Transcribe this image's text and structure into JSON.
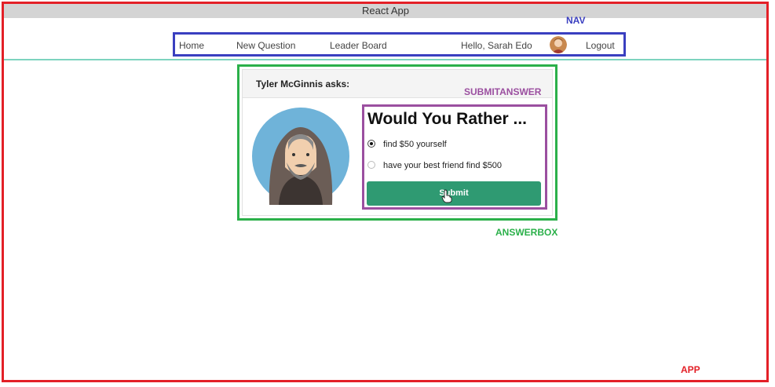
{
  "window": {
    "title": "React App"
  },
  "nav": {
    "items": [
      {
        "label": "Home"
      },
      {
        "label": "New Question"
      },
      {
        "label": "Leader Board"
      }
    ],
    "greeting": "Hello, Sarah Edo",
    "logout_label": "Logout"
  },
  "annotations": {
    "nav": "NAV",
    "submitanswer": "SUBMITANSWER",
    "answerbox": "ANSWERBOX",
    "app": "APP"
  },
  "annotation_colors": {
    "app": "#e32027",
    "nav": "#3a3fc0",
    "answerbox": "#2bb04a",
    "submitanswer": "#9b4fa0"
  },
  "card": {
    "asker": "Tyler McGinnis asks:",
    "heading": "Would You Rather ...",
    "options": [
      {
        "label": "find $50 yourself",
        "checked": true
      },
      {
        "label": "have your best friend find $500",
        "checked": false
      }
    ],
    "submit_label": "Submit"
  },
  "theme": {
    "accent": "#2f9a72",
    "nav_underline": "#7dd3bf"
  }
}
